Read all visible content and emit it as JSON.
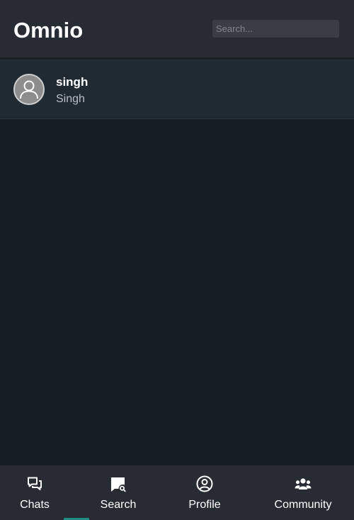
{
  "header": {
    "title": "Omnio",
    "search_placeholder": "Search..."
  },
  "chat_list": [
    {
      "name": "singh",
      "subtitle": "Singh",
      "avatar_icon": "user-icon"
    }
  ],
  "bottom_nav": {
    "active_tab": "Search",
    "items": [
      {
        "label": "Chats",
        "icon": "chats-icon"
      },
      {
        "label": "Search",
        "icon": "message-search-icon"
      },
      {
        "label": "Profile",
        "icon": "user-circle-icon"
      },
      {
        "label": "Community",
        "icon": "users-icon"
      }
    ]
  },
  "colors": {
    "background": "#161c23",
    "header": "#272b34",
    "chat_item": "#1f2a33",
    "accent": "#1e8c80"
  }
}
